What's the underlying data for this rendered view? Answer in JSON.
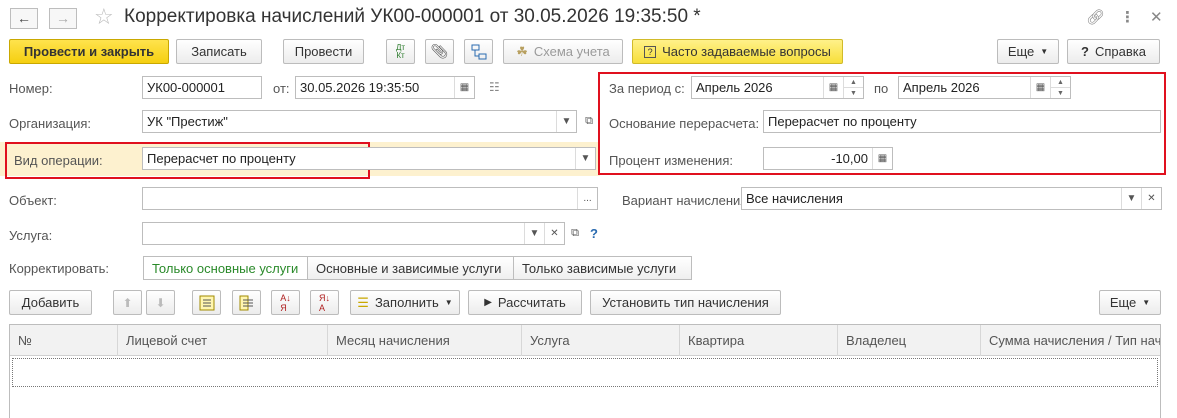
{
  "window": {
    "title": "Корректировка начислений УК00-000001 от 30.05.2026 19:35:50 *",
    "back_icon": "arrow-left-icon",
    "forward_icon": "arrow-right-icon",
    "favorite_icon": "star-icon",
    "link_icon": "link-icon",
    "menu_icon": "more-vertical-icon",
    "close_icon": "close-icon"
  },
  "toolbar": {
    "post_close": "Провести и закрыть",
    "save": "Записать",
    "post": "Провести",
    "dt_kt": "ДтКт",
    "attach_icon": "paperclip-icon",
    "structure_icon": "structure-icon",
    "accounting_scheme": "Схема учета",
    "faq": "Часто задаваемые вопросы",
    "more": "Еще",
    "help": "Справка"
  },
  "form": {
    "number_label": "Номер:",
    "number": "УК00-000001",
    "from_label": "от:",
    "date": "30.05.2026 19:35:50",
    "org_label": "Организация:",
    "org": "УК \"Престиж\"",
    "op_label": "Вид операции:",
    "op": "Перерасчет по проценту",
    "object_label": "Объект:",
    "object": "",
    "service_label": "Услуга:",
    "service": "",
    "help_q": "?",
    "period_label": "За период с:",
    "period_from": "Апрель 2026",
    "period_to_label": "по",
    "period_to": "Апрель 2026",
    "basis_label": "Основание перерасчета:",
    "basis": "Перерасчет по проценту",
    "percent_label": "Процент изменения:",
    "percent": "-10,00",
    "variant_label": "Вариант начисления:",
    "variant": "Все начисления",
    "correct_label": "Корректировать:",
    "correct_options": [
      "Только основные услуги",
      "Основные и зависимые услуги",
      "Только зависимые услуги"
    ]
  },
  "table_toolbar": {
    "add": "Добавить",
    "fill": "Заполнить",
    "calculate": "Рассчитать",
    "set_type": "Установить тип начисления",
    "more": "Еще"
  },
  "table": {
    "columns": [
      "№",
      "Лицевой счет",
      "Месяц начисления",
      "Услуга",
      "Квартира",
      "Владелец",
      "Сумма начисления / Тип нач"
    ]
  },
  "colors": {
    "primary_button": "#f5cf10",
    "highlight_box": "#e0101e",
    "active_segment_text": "#2a8a2a"
  }
}
